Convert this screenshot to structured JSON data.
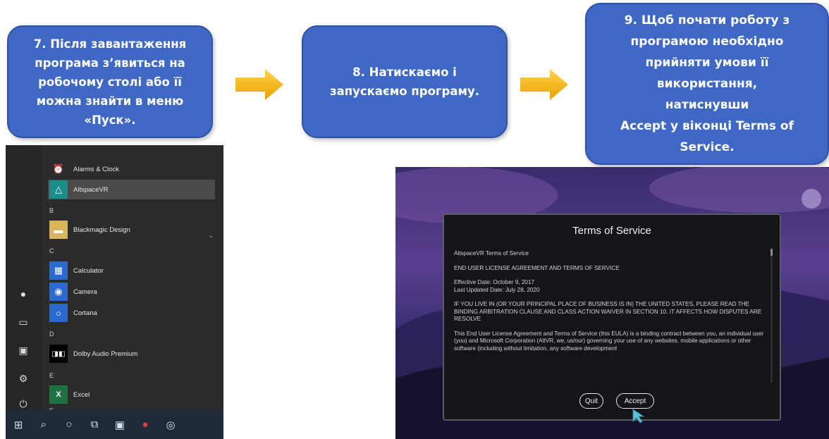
{
  "steps": {
    "step7": [
      "7. Після завантаження",
      "програма з’явиться на",
      "робочому столі або її",
      "можна знайти в меню",
      "«Пуск»."
    ],
    "step8": [
      "8. Натискаємо і",
      "запускаємо програму."
    ],
    "step9": [
      "9. Щоб почати роботу з",
      "програмою необхідно",
      "прийняти умови її",
      "використання, натиснувши",
      "Accept у віконці Terms of",
      "Service."
    ]
  },
  "colors": {
    "box_fill": "#3f67c4",
    "arrow": "#f4b400",
    "vr_bg": "#372b6b"
  },
  "start_menu": {
    "items": [
      {
        "label": "Alarms & Clock",
        "icon": "alarm-clock-icon",
        "tile_color": "#2b2b2b"
      },
      {
        "label": "AltspaceVR",
        "icon": "altspacevr-icon",
        "tile_color": "#1a8c8c",
        "selected": true
      },
      {
        "label": "Blackmagic Design",
        "icon": "folder-icon",
        "tile_color": "#d9b65c"
      },
      {
        "label": "Calculator",
        "icon": "calculator-icon",
        "tile_color": "#2a6bd1"
      },
      {
        "label": "Camera",
        "icon": "camera-icon",
        "tile_color": "#2a6bd1"
      },
      {
        "label": "Cortana",
        "icon": "cortana-icon",
        "tile_color": "#2a6bd1"
      },
      {
        "label": "Dolby Audio Premium",
        "icon": "dolby-icon",
        "tile_color": "#000000"
      },
      {
        "label": "Excel",
        "icon": "excel-icon",
        "tile_color": "#1f7244"
      }
    ],
    "letters": [
      "B",
      "C",
      "D",
      "E",
      "F"
    ]
  },
  "tos": {
    "title": "Terms of Service",
    "paragraphs": [
      "AltspaceVR Terms of Service",
      "END USER LICENSE AGREEMENT AND TERMS OF SERVICE",
      "Effective Date: October 9, 2017\nLast Updated Date: July 28, 2020",
      "IF YOU LIVE IN (OR YOUR PRINCIPAL PLACE OF BUSINESS IS IN) THE UNITED STATES, PLEASE READ THE BINDING ARBITRATION CLAUSE AND CLASS ACTION WAIVER IN SECTION 10. IT AFFECTS HOW DISPUTES ARE RESOLVE",
      "This End User License Agreement and Terms of Service (this EULA) is a binding contract between you, an individual user (you) and Microsoft Corporation (AltVR, we, us/our) governing your use of any websites, mobile applications or other software (including without limitation, any software development"
    ],
    "quit_label": "Quit",
    "accept_label": "Accept"
  }
}
